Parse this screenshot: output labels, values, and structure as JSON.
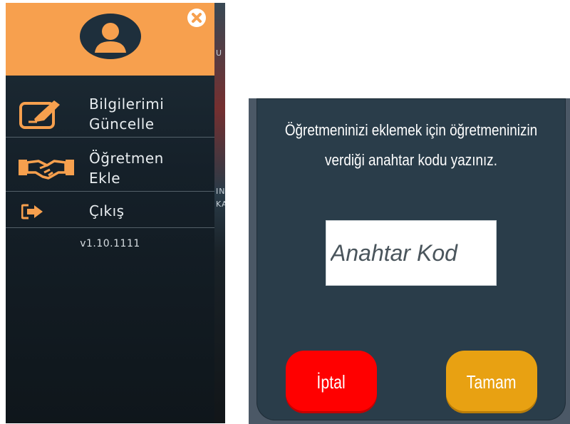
{
  "drawer": {
    "menu_items": [
      {
        "label": "Bilgilerimi\nGüncelle",
        "icon": "edit-icon"
      },
      {
        "label": "Öğretmen\nEkle",
        "icon": "handshake-icon"
      },
      {
        "label": "Çıkış",
        "icon": "sign-out-icon"
      }
    ],
    "version": "v1.10.1111",
    "avatar_icon": "user-avatar-icon",
    "close_icon": "close-icon",
    "header_color": "#f7a04e",
    "background_peek_text": [
      "IN",
      "KA",
      "U"
    ]
  },
  "dialog": {
    "message": "Öğretmeninizi eklemek için öğretmeninizin\nverdiği anahtar kodu yazınız.",
    "input_placeholder": "Anahtar Kod",
    "input_value": "",
    "cancel_label": "İptal",
    "ok_label": "Tamam",
    "colors": {
      "background": "#2a3d4a",
      "cancel": "#ff0000",
      "ok": "#e8a112"
    }
  }
}
